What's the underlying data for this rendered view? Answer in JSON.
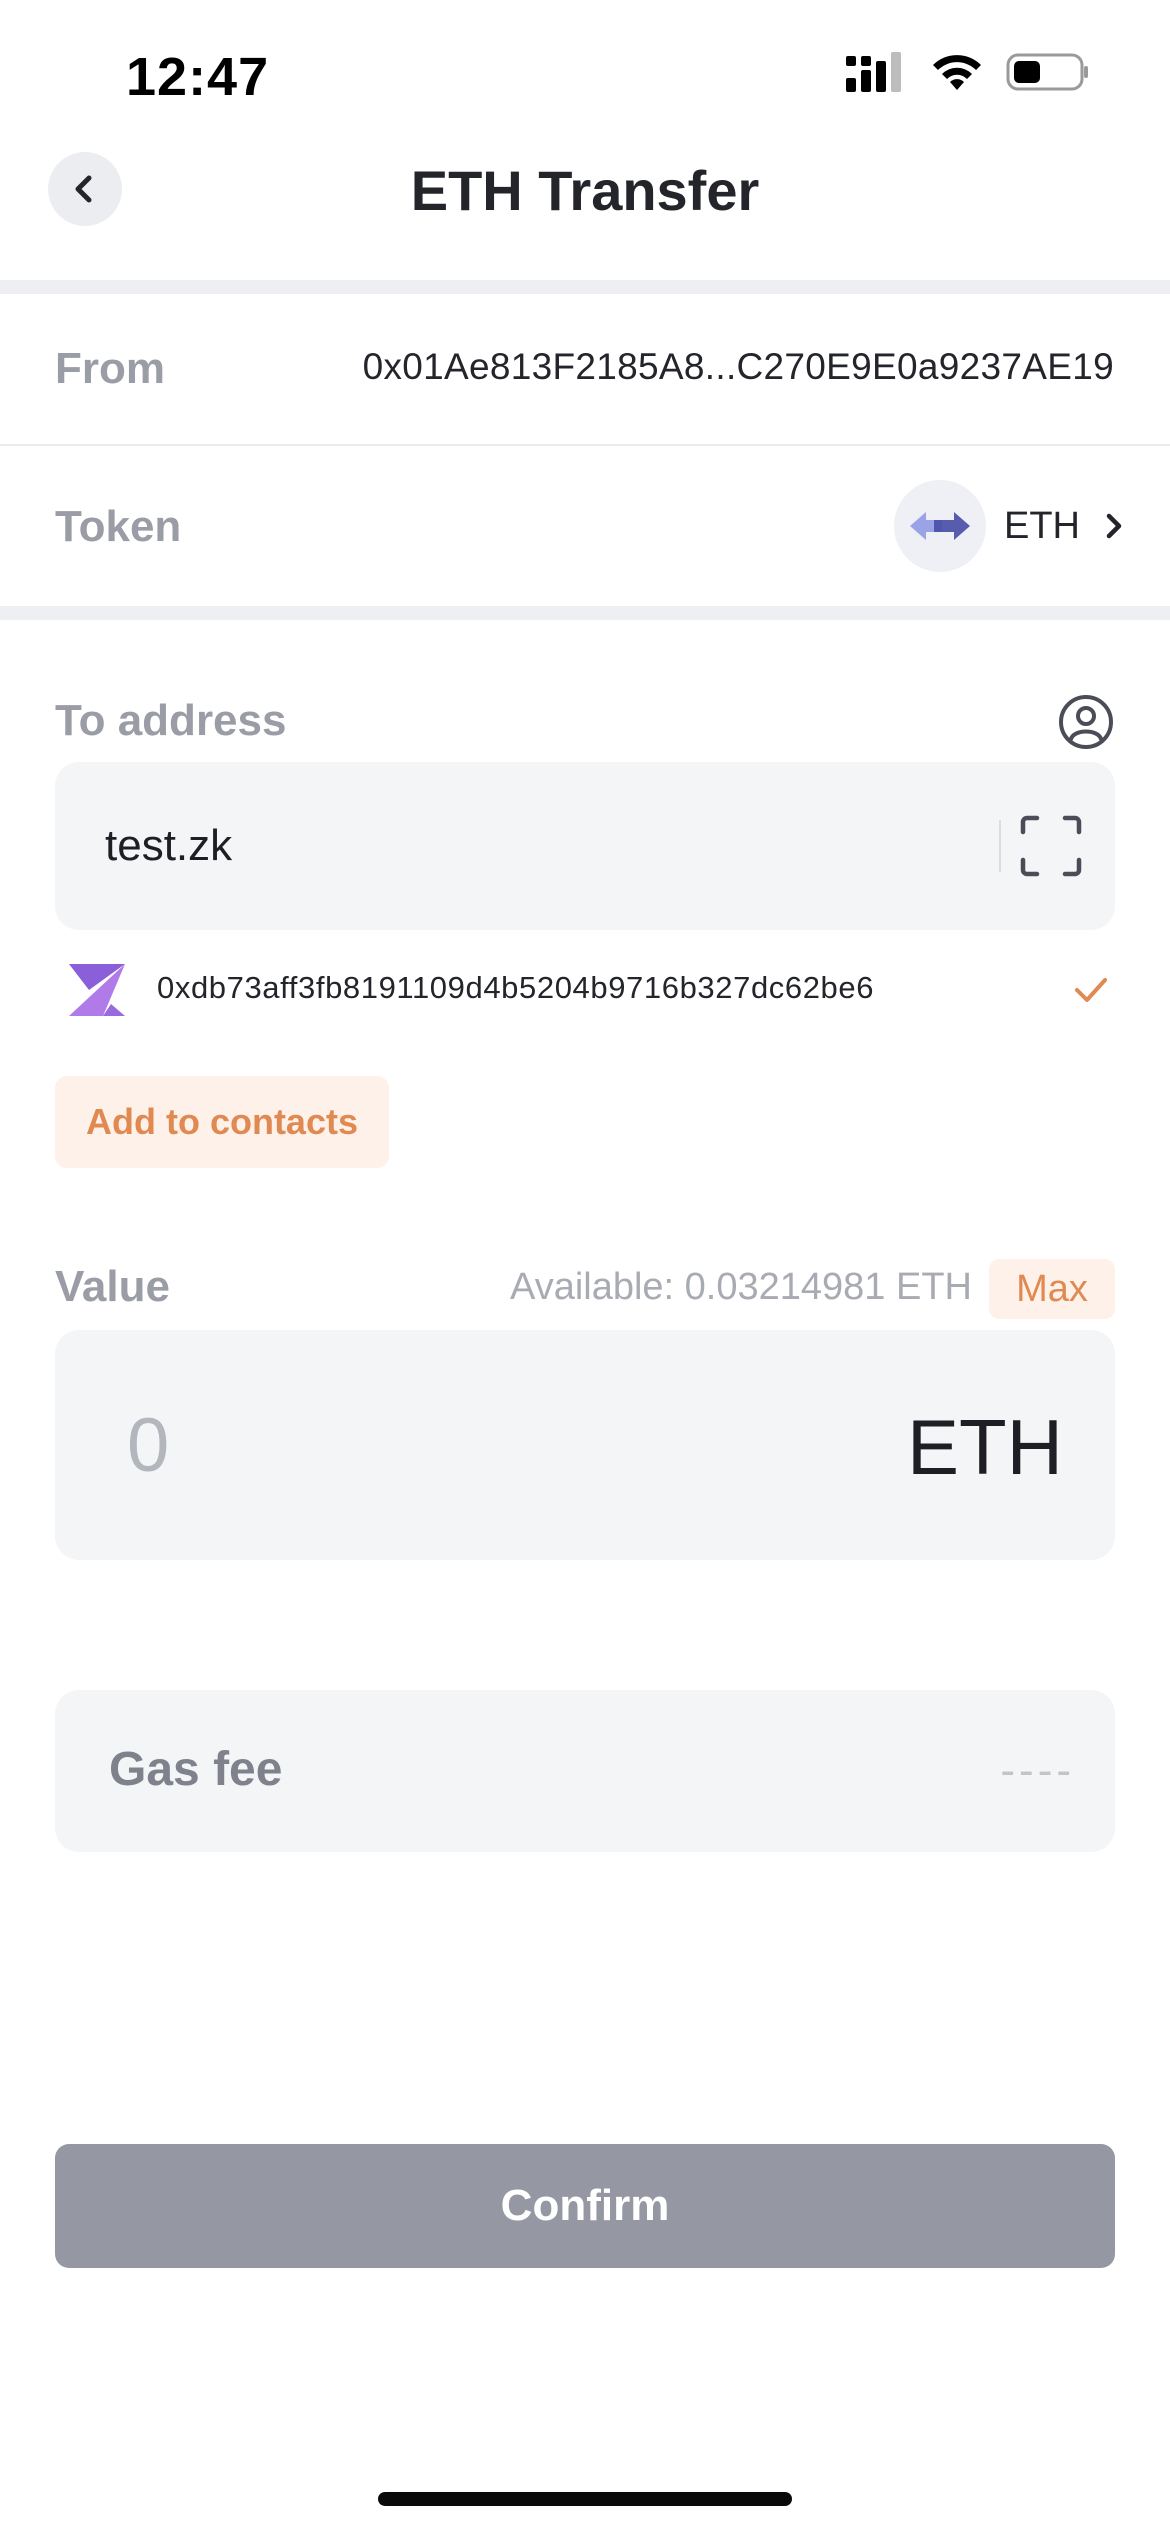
{
  "status_bar": {
    "time": "12:47",
    "icons": [
      "cellular-signal-icon",
      "wifi-icon",
      "battery-icon"
    ]
  },
  "nav": {
    "back_icon": "chevron-left-icon",
    "title": "ETH Transfer"
  },
  "from": {
    "label": "From",
    "value": "0x01Ae813F2185A8...C270E9E0a9237AE19"
  },
  "token": {
    "label": "Token",
    "name": "ETH",
    "icon": "token-bridge-icon",
    "chevron_icon": "chevron-right-icon"
  },
  "to_address": {
    "label": "To address",
    "contact_icon": "user-circle-icon",
    "input_value": "test.zk",
    "scan_icon": "scan-icon",
    "resolved_address": "0xdb73aff3fb8191109d4b5204b9716b327dc62be6",
    "resolved_logo": "zk-logo-icon",
    "check_icon": "check-icon"
  },
  "add_contacts": {
    "label": "Add to contacts"
  },
  "value": {
    "label": "Value",
    "available": "Available: 0.03214981 ETH",
    "max_label": "Max",
    "placeholder": "0",
    "unit": "ETH"
  },
  "gas": {
    "label": "Gas fee",
    "value": "----"
  },
  "confirm": {
    "label": "Confirm"
  },
  "colors": {
    "accent": "#e08a52",
    "accent_bg": "#fdf1e9",
    "field_bg": "#f4f5f7",
    "disabled_button": "#9598a3",
    "label_gray": "#9a9ca6"
  }
}
